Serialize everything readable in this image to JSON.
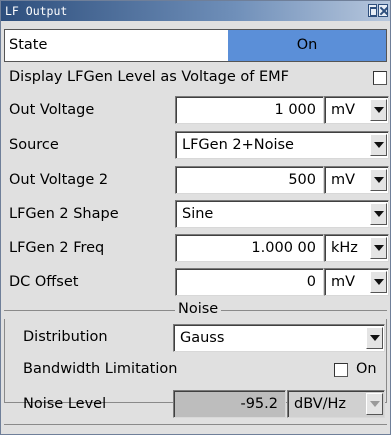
{
  "window": {
    "title": "LF Output"
  },
  "state": {
    "label": "State",
    "value": "On"
  },
  "display_emf": {
    "label": "Display LFGen Level as Voltage of EMF",
    "checked": false
  },
  "out_voltage": {
    "label": "Out Voltage",
    "value": "1 000",
    "unit": "mV"
  },
  "source": {
    "label": "Source",
    "value": "LFGen 2+Noise"
  },
  "out_voltage_2": {
    "label": "Out Voltage 2",
    "value": "500",
    "unit": "mV"
  },
  "lfgen2_shape": {
    "label": "LFGen 2 Shape",
    "value": "Sine"
  },
  "lfgen2_freq": {
    "label": "LFGen 2 Freq",
    "value": "1.000 00",
    "unit": "kHz"
  },
  "dc_offset": {
    "label": "DC Offset",
    "value": "0",
    "unit": "mV"
  },
  "noise": {
    "section_title": "Noise",
    "distribution": {
      "label": "Distribution",
      "value": "Gauss"
    },
    "bandwidth_limitation": {
      "label": "Bandwidth Limitation",
      "checkbox_label": "On",
      "checked": false
    },
    "noise_level": {
      "label": "Noise Level",
      "value": "-95.2",
      "unit": "dBV/Hz"
    }
  },
  "colors": {
    "title_bar": "#2e4f7d",
    "state_on": "#5b8fd8",
    "panel_bg": "#e0e0e0"
  }
}
